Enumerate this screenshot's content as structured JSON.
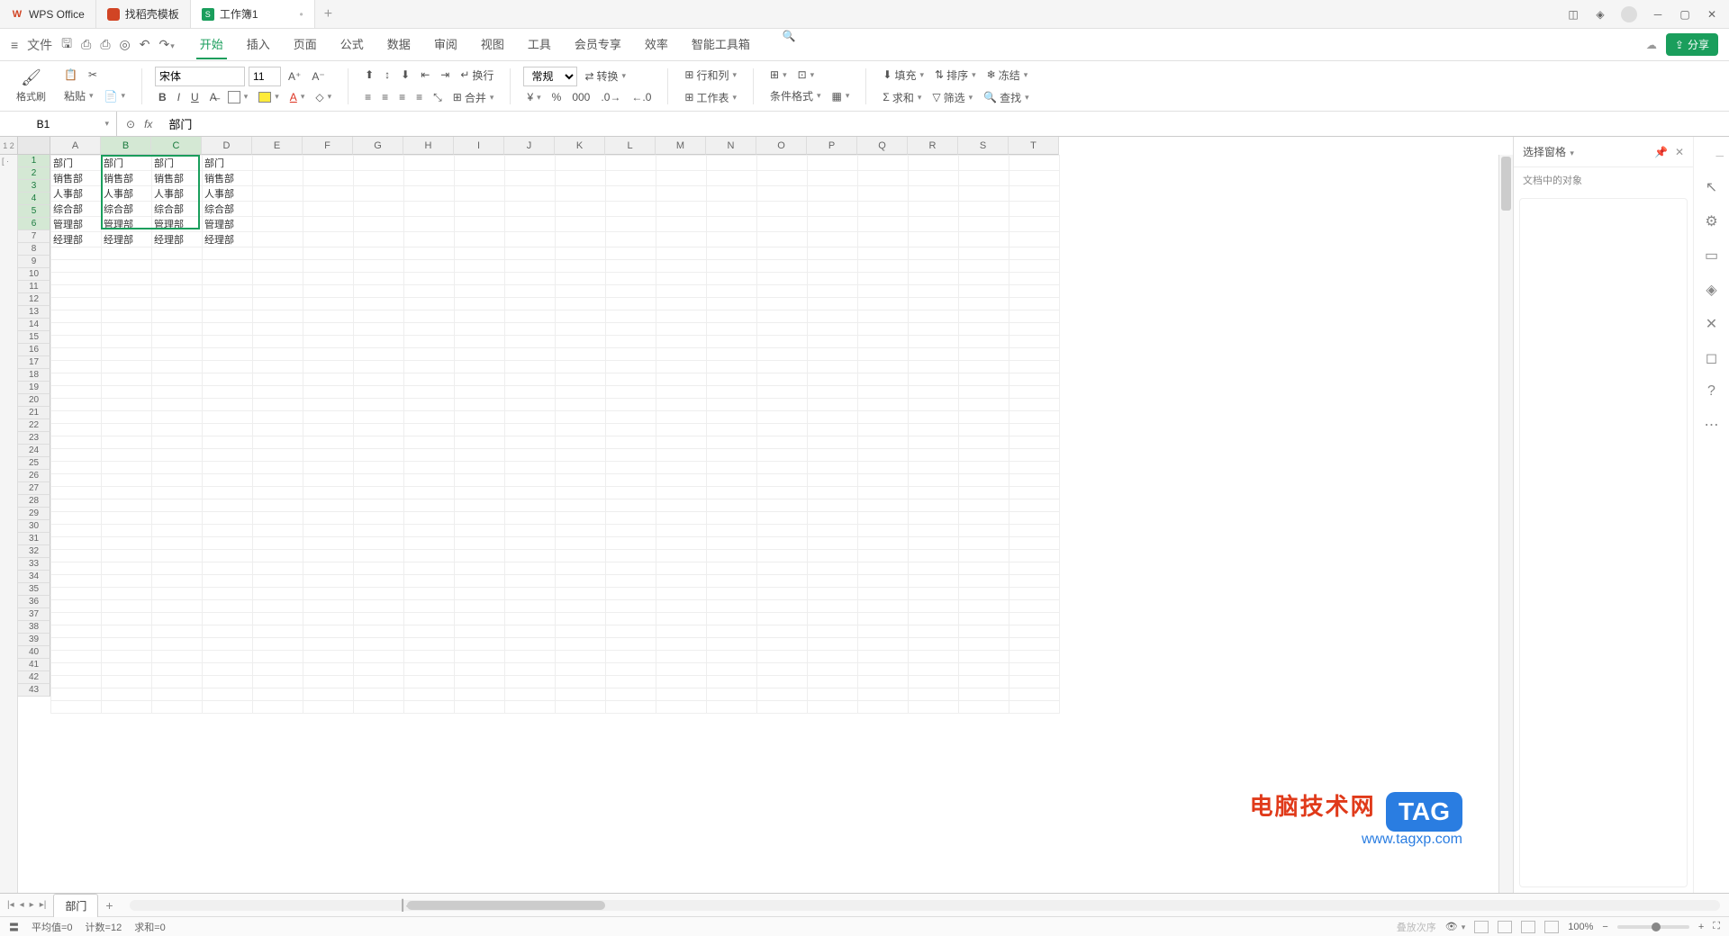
{
  "titlebar": {
    "tabs": [
      {
        "label": "WPS Office",
        "icon_color": "#d14424"
      },
      {
        "label": "找稻壳模板",
        "icon_color": "#d14424"
      },
      {
        "label": "工作簿1",
        "icon_color": "#1a9e5c",
        "active": true
      }
    ]
  },
  "menu": {
    "file": "文件",
    "tabs": [
      "开始",
      "插入",
      "页面",
      "公式",
      "数据",
      "审阅",
      "视图",
      "工具",
      "会员专享",
      "效率",
      "智能工具箱"
    ],
    "active": "开始"
  },
  "share_label": "分享",
  "ribbon": {
    "format_painter": "格式刷",
    "paste": "粘贴",
    "font_name": "宋体",
    "font_size": "11",
    "wrap": "换行",
    "number_format": "常规",
    "convert": "转换",
    "row_col": "行和列",
    "worksheet": "工作表",
    "cond_fmt": "条件格式",
    "fill": "填充",
    "sort": "排序",
    "freeze": "冻结",
    "sum": "求和",
    "filter": "筛选",
    "find": "查找",
    "merge": "合并"
  },
  "namebox": "B1",
  "formula": "部门",
  "columns": [
    "A",
    "B",
    "C",
    "D",
    "E",
    "F",
    "G",
    "H",
    "I",
    "J",
    "K",
    "L",
    "M",
    "N",
    "O",
    "P",
    "Q",
    "R",
    "S",
    "T"
  ],
  "cells": {
    "rows": [
      [
        "部门",
        "部门",
        "部门",
        "部门"
      ],
      [
        "销售部",
        "销售部",
        "销售部",
        "销售部"
      ],
      [
        "人事部",
        "人事部",
        "人事部",
        "人事部"
      ],
      [
        "综合部",
        "综合部",
        "综合部",
        "综合部"
      ],
      [
        "管理部",
        "管理部",
        "管理部",
        "管理部"
      ],
      [
        "经理部",
        "经理部",
        "经理部",
        "经理部"
      ]
    ]
  },
  "selection": {
    "col_start": 1,
    "col_end": 2,
    "row_start": 0,
    "row_end": 5
  },
  "rightpanel": {
    "title": "选择窗格",
    "subtitle": "文档中的对象"
  },
  "sheet": {
    "name": "部门"
  },
  "statusbar": {
    "left_icon": "〓",
    "avg": "平均值=0",
    "count": "计数=12",
    "sum": "求和=0",
    "order": "叠放次序",
    "zoom": "100%"
  },
  "watermark": {
    "text1": "电脑技术网",
    "url": "www.tagxp.com",
    "tag": "TAG"
  }
}
